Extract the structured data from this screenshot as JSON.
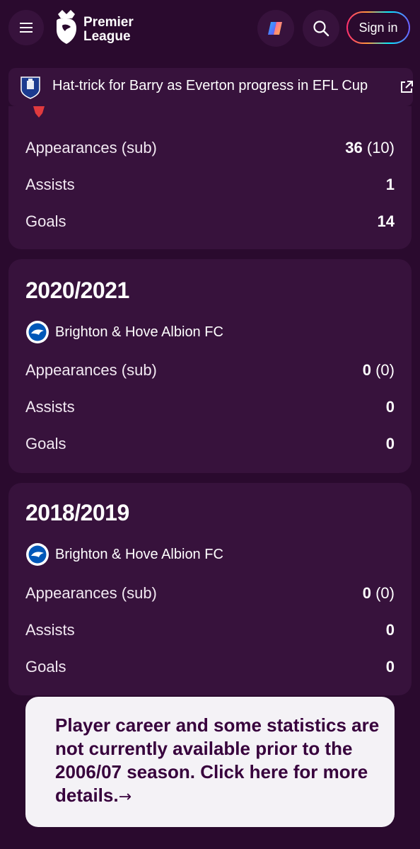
{
  "header": {
    "logo_line1": "Premier",
    "logo_line2": "League",
    "sign_in_label": "Sign in"
  },
  "banner": {
    "text": "Hat-trick for Barry as Everton progress in EFL Cup"
  },
  "stats_labels": {
    "appearances": "Appearances (sub)",
    "assists": "Assists",
    "goals": "Goals"
  },
  "cards": [
    {
      "apps": "36",
      "subs": "(10)",
      "assists": "1",
      "goals": "14"
    },
    {
      "season": "2020/2021",
      "club": "Brighton & Hove Albion FC",
      "apps": "0",
      "subs": "(0)",
      "assists": "0",
      "goals": "0"
    },
    {
      "season": "2018/2019",
      "club": "Brighton & Hove Albion FC",
      "apps": "0",
      "subs": "(0)",
      "assists": "0",
      "goals": "0"
    }
  ],
  "notice": {
    "text": "Player career and some statistics are not currently available prior to the 2006/07 season. Click here for more details.",
    "arrow": "→"
  },
  "colors": {
    "background": "#2a0a2e",
    "card": "#37123c",
    "notice_bg": "#f4f2f6",
    "notice_text": "#37003c"
  }
}
